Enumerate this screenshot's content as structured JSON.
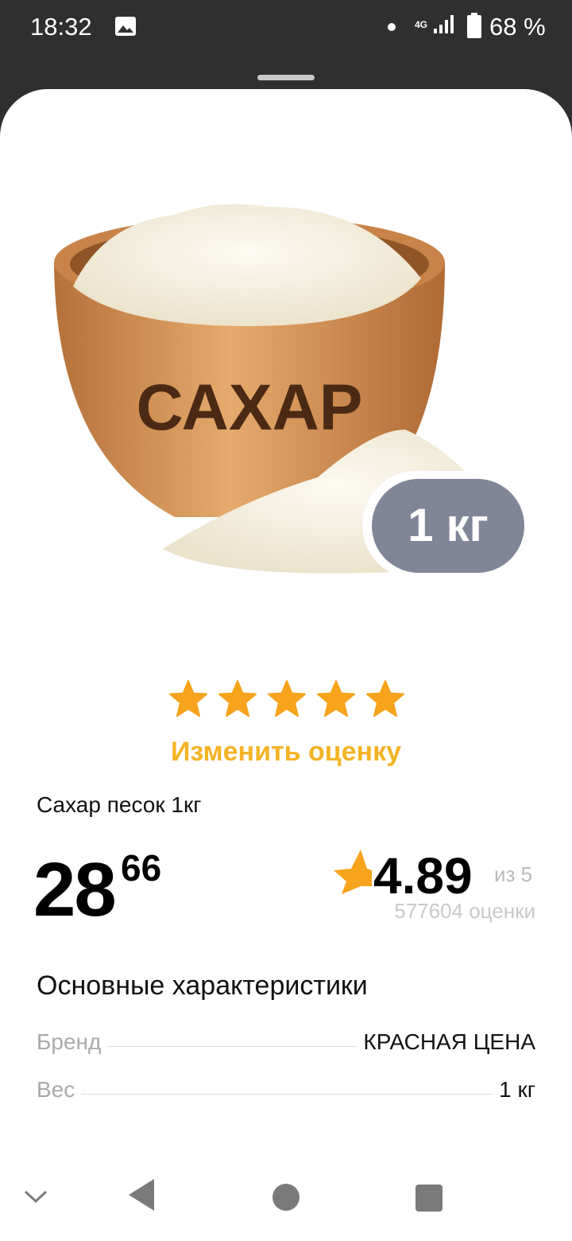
{
  "status_bar": {
    "time": "18:32",
    "network": "4G",
    "battery_percent": "68 %",
    "icons": [
      "image-icon",
      "dot-icon",
      "signal-icon",
      "battery-icon"
    ]
  },
  "product": {
    "image_label": "САХАР",
    "weight_badge": "1 кг",
    "name": "Сахар песок 1кг",
    "price_int": "28",
    "price_frac": "66"
  },
  "rating": {
    "user_stars": 5,
    "change_rating_label": "Изменить оценку",
    "value": "4.89",
    "of_label": "из 5",
    "count_label": "577604 оценки"
  },
  "specs": {
    "title": "Основные характеристики",
    "rows": [
      {
        "label": "Бренд",
        "value": "КРАСНАЯ ЦЕНА"
      },
      {
        "label": "Вес",
        "value": "1 кг"
      }
    ]
  },
  "colors": {
    "accent": "#f5b324",
    "badge": "#808597",
    "star": "#f7a31b"
  }
}
